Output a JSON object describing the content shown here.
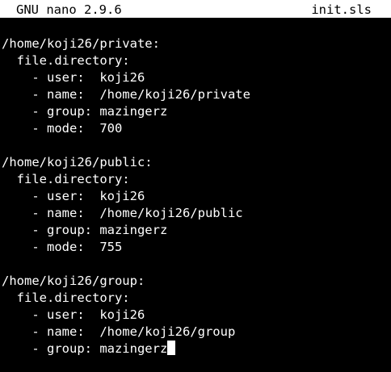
{
  "app": {
    "title": "GNU nano 2.9.6",
    "filename": "init.sls"
  },
  "colors": {
    "background": "#000000",
    "text": "#ffffff",
    "title_bar_bg": "#ffffff",
    "title_bar_text": "#000000"
  },
  "editor": {
    "lines": [
      "/home/koji26/private:",
      "  file.directory:",
      "    - user:  koji26",
      "    - name:  /home/koji26/private",
      "    - group: mazingerz",
      "    - mode:  700",
      "",
      "/home/koji26/public:",
      "  file.directory:",
      "    - user:  koji26",
      "    - name:  /home/koji26/public",
      "    - group: mazingerz",
      "    - mode:  755",
      "",
      "/home/koji26/group:",
      "  file.directory:",
      "    - user:  koji26",
      "    - name:  /home/koji26/group",
      "    - group: mazingerz"
    ]
  }
}
